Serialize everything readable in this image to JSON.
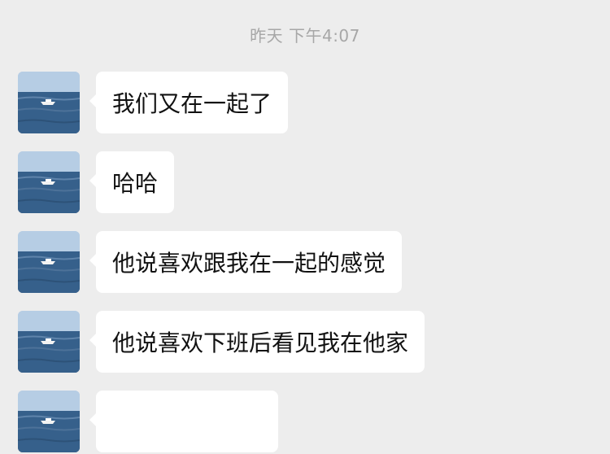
{
  "timestamp": "昨天 下午4:07",
  "messages": [
    {
      "text": "我们又在一起了"
    },
    {
      "text": "哈哈"
    },
    {
      "text": "他说喜欢跟我在一起的感觉"
    },
    {
      "text": "他说喜欢下班后看见我在他家"
    },
    {
      "text": ""
    }
  ],
  "colors": {
    "background": "#ededed",
    "bubble": "#ffffff",
    "timestamp_text": "#a7a7a7",
    "message_text": "#111111"
  },
  "icons": {
    "avatar": "sea-boat-photo-avatar"
  }
}
